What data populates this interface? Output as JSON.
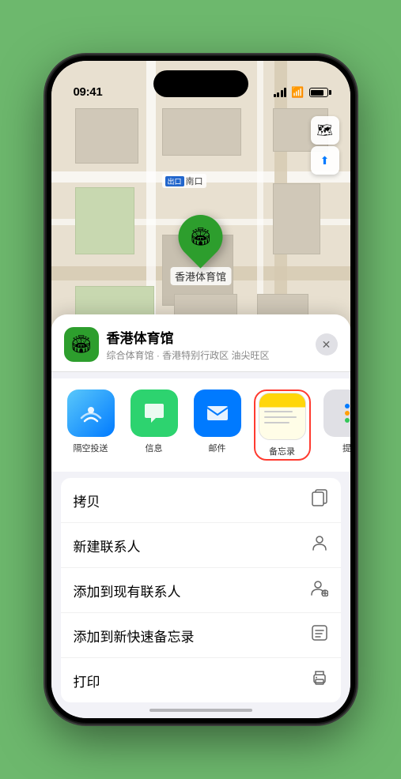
{
  "status_bar": {
    "time": "09:41",
    "location_arrow": "▶"
  },
  "map": {
    "label_badge": "出口",
    "label_text": "南口",
    "pin_emoji": "🏟",
    "pin_label": "香港体育馆",
    "control_map": "🗺",
    "control_location": "➤"
  },
  "sheet": {
    "venue_emoji": "🏟",
    "venue_name": "香港体育馆",
    "venue_subtitle": "综合体育馆 · 香港特别行政区 油尖旺区",
    "close_label": "✕"
  },
  "share_items": [
    {
      "label": "隔空投送",
      "type": "airdrop"
    },
    {
      "label": "信息",
      "type": "messages"
    },
    {
      "label": "邮件",
      "type": "mail"
    },
    {
      "label": "备忘录",
      "type": "notes",
      "highlighted": true
    },
    {
      "label": "提",
      "type": "more"
    }
  ],
  "actions": [
    {
      "label": "拷贝",
      "icon": "copy"
    },
    {
      "label": "新建联系人",
      "icon": "person"
    },
    {
      "label": "添加到现有联系人",
      "icon": "person-add"
    },
    {
      "label": "添加到新快速备忘录",
      "icon": "note"
    },
    {
      "label": "打印",
      "icon": "print"
    }
  ]
}
